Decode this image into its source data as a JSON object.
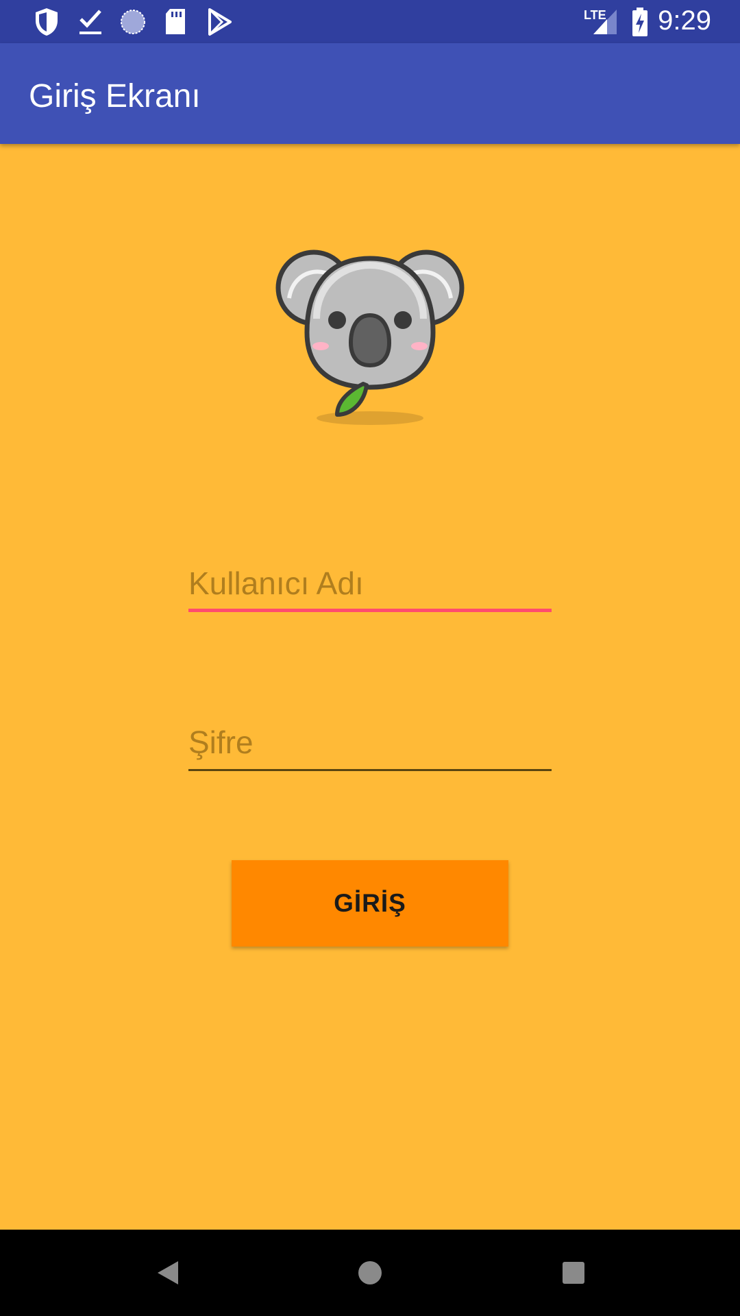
{
  "status_bar": {
    "time": "9:29",
    "network_label": "LTE",
    "left_icons": [
      "shield-icon",
      "download-done-icon",
      "sync-circle-icon",
      "sd-card-icon",
      "play-store-icon"
    ],
    "right_icons": [
      "signal-icon",
      "battery-icon"
    ]
  },
  "app_bar": {
    "title": "Giriş Ekranı"
  },
  "logo": {
    "icon": "koala-icon"
  },
  "form": {
    "username_placeholder": "Kullanıcı Adı",
    "username_value": "",
    "password_placeholder": "Şifre",
    "password_value": "",
    "login_label": "GİRİŞ"
  },
  "nav_bar": {
    "icons": [
      "back-icon",
      "home-icon",
      "recents-icon"
    ]
  },
  "colors": {
    "status_bar": "#303F9F",
    "app_bar": "#3F51B5",
    "background": "#FFBA37",
    "button": "#FF8800",
    "focused_underline": "#FF4B6E"
  }
}
